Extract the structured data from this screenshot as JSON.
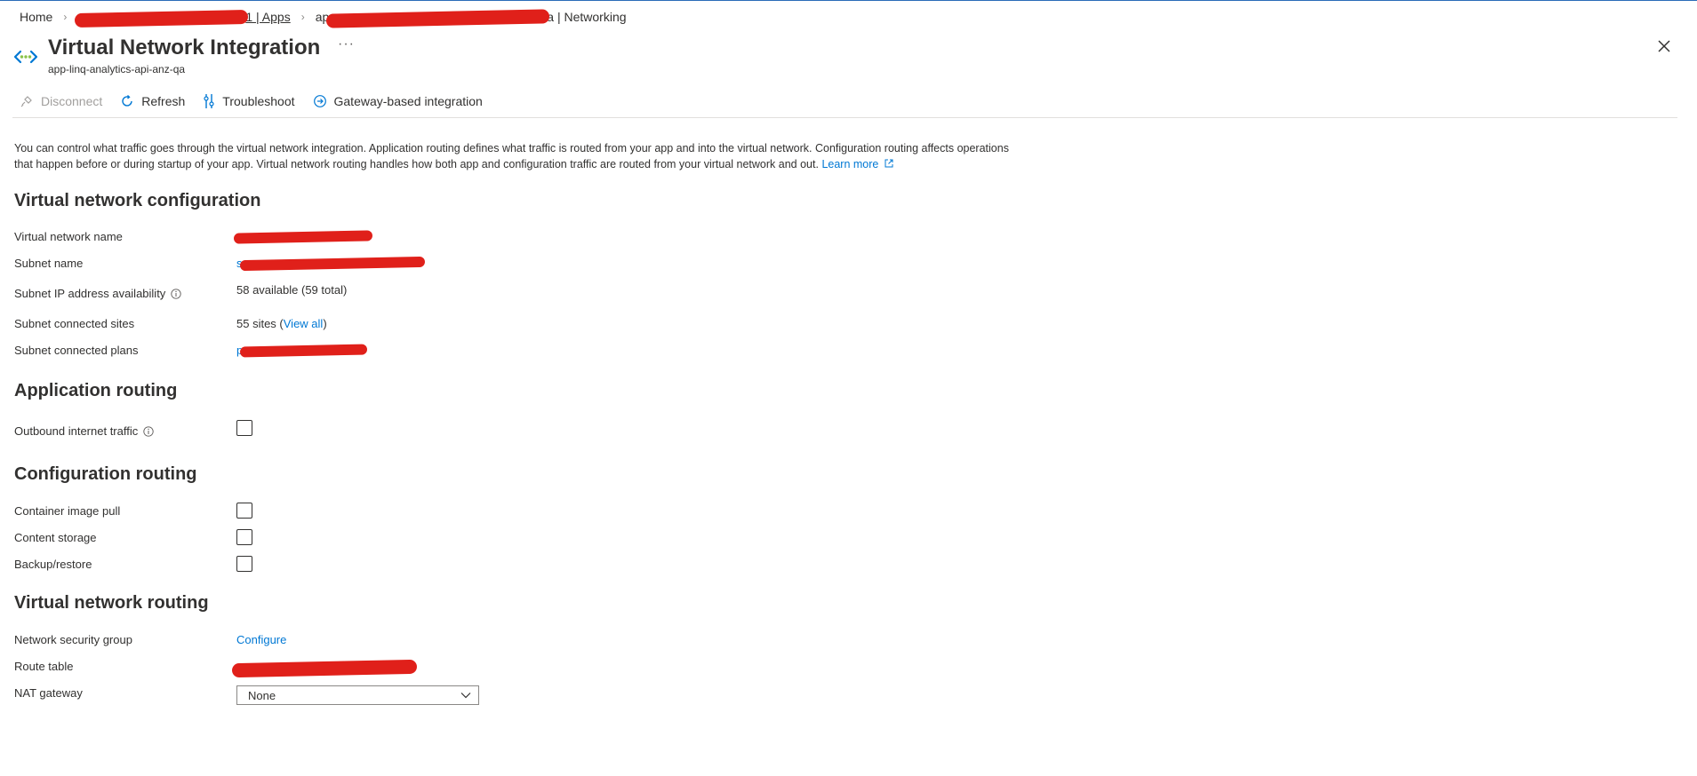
{
  "breadcrumb": {
    "home": "Home",
    "item2_tail": "1 | Apps",
    "item3_head": "ap",
    "item3_tail": "a | Networking"
  },
  "header": {
    "title": "Virtual Network Integration",
    "subtitle": "app-linq-analytics-api-anz-qa",
    "more": "···"
  },
  "toolbar": {
    "disconnect": "Disconnect",
    "refresh": "Refresh",
    "troubleshoot": "Troubleshoot",
    "gateway": "Gateway-based integration"
  },
  "description": {
    "line1": "You can control what traffic goes through the virtual network integration. Application routing defines what traffic is routed from your app and into the virtual network. Configuration routing affects operations",
    "line2": "that happen before or during startup of your app. Virtual network routing handles how both app and configuration traffic are routed from your virtual network and out.",
    "learn_more": "Learn more"
  },
  "vnet_config": {
    "heading": "Virtual network configuration",
    "vnet_name_label": "Virtual network name",
    "subnet_name_label": "Subnet name",
    "subnet_name_visible_head": "s",
    "subnet_ip_label": "Subnet IP address availability",
    "subnet_ip_value": "58 available (59 total)",
    "connected_sites_label": "Subnet connected sites",
    "connected_sites_prefix": "55 sites (",
    "connected_sites_link": "View all",
    "connected_sites_suffix": ")",
    "connected_plans_label": "Subnet connected plans",
    "connected_plans_visible_head": "p"
  },
  "app_routing": {
    "heading": "Application routing",
    "outbound_label": "Outbound internet traffic",
    "outbound_checked": false
  },
  "config_routing": {
    "heading": "Configuration routing",
    "container_label": "Container image pull",
    "content_label": "Content storage",
    "backup_label": "Backup/restore"
  },
  "vnet_routing": {
    "heading": "Virtual network routing",
    "nsg_label": "Network security group",
    "nsg_link": "Configure",
    "route_table_label": "Route table",
    "nat_label": "NAT gateway",
    "nat_value": "None"
  },
  "colors": {
    "accent": "#0078d4",
    "text": "#323130",
    "redaction": "#e0201a"
  }
}
